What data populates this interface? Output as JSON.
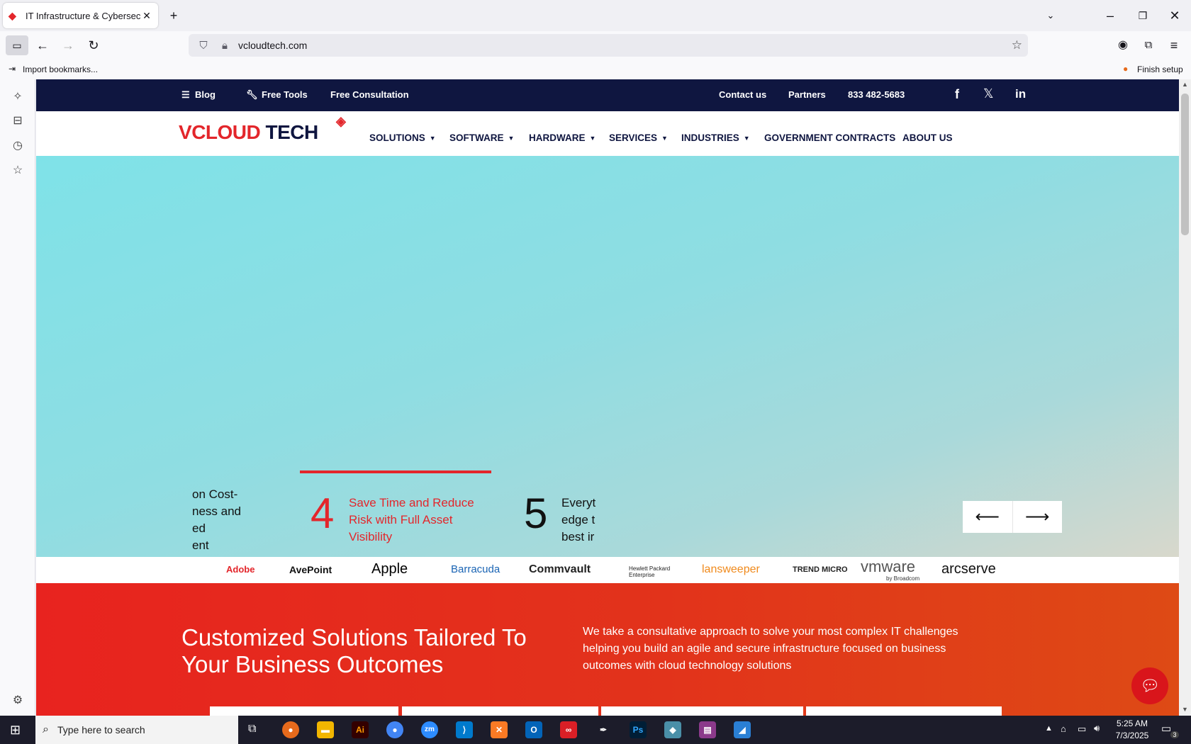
{
  "browser": {
    "tab_title": "IT Infrastructure & Cybersecurity",
    "tab_close": "✕",
    "new_tab": "+",
    "url": "vcloudtech.com",
    "bookmark_import": "Import bookmarks...",
    "finish_setup": "Finish setup"
  },
  "topbar": {
    "blog": "Blog",
    "free_tools": "Free Tools",
    "free_consultation": "Free Consultation",
    "contact": "Contact us",
    "partners": "Partners",
    "phone": "833 482-5683",
    "social": [
      "f",
      "𝕏",
      "in"
    ]
  },
  "logo": {
    "part1": "V",
    "part2": "CLOUD",
    "part3": " TECH"
  },
  "nav": {
    "items": [
      "SOLUTIONS",
      "SOFTWARE",
      "HARDWARE",
      "SERVICES",
      "INDUSTRIES",
      "GOVERNMENT CONTRACTS",
      "ABOUT US"
    ],
    "caret": "▼"
  },
  "slider": {
    "partial_left": [
      "on Cost-",
      "ness and",
      "ed",
      "ent"
    ],
    "slide4_number": "4",
    "slide4_text": [
      "Save Time and Reduce",
      "Risk with Full Asset",
      "Visibility"
    ],
    "slide5_number": "5",
    "slide5_text": [
      "Everyt",
      "edge t",
      "best ir"
    ],
    "prev": "⟵",
    "next": "⟶"
  },
  "brands": [
    "Adobe",
    "AvePoint",
    "Apple",
    "Barracuda",
    "Commvault",
    "Hewlett Packard Enterprise",
    "lansweeper",
    "TREND MICRO",
    "vmware",
    "by Broadcom",
    "arcserve"
  ],
  "section": {
    "heading": "Customized Solutions Tailored To Your Business Outcomes",
    "body": "We take a consultative approach to solve your most complex IT challenges helping you build an agile and secure infrastructure focused on business outcomes with cloud technology solutions"
  },
  "taskbar": {
    "search_placeholder": "Type here to search",
    "time": "5:25 AM",
    "date": "7/3/2025",
    "notif_count": "3"
  },
  "colors": {
    "navy": "#0f1640",
    "red": "#e3262b",
    "accent_orange": "#de4a15"
  }
}
